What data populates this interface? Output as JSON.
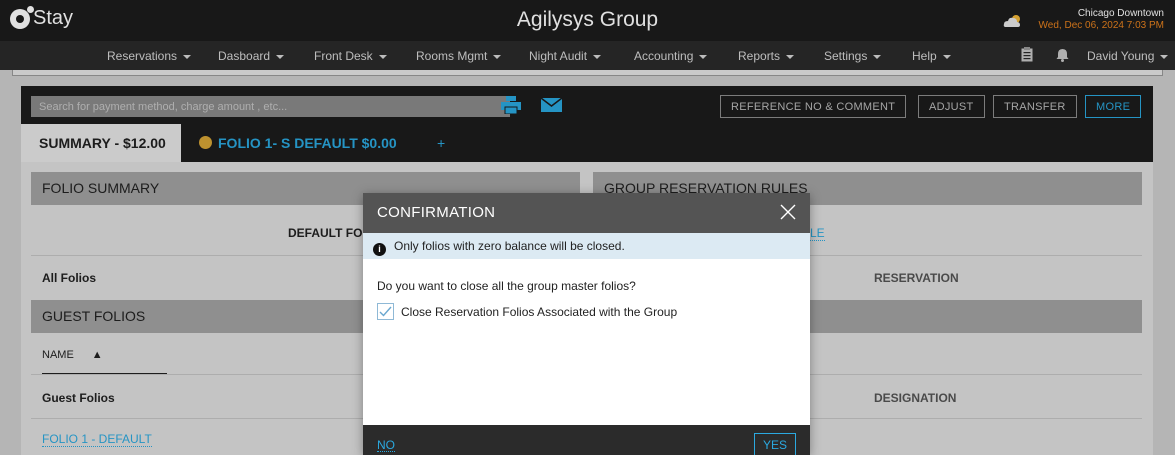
{
  "header": {
    "logo_text": "Stay",
    "title": "Agilysys Group",
    "location": "Chicago Downtown",
    "datetime": "Wed, Dec 06, 2024 7:03 PM",
    "weather_icon": "cloud-icon",
    "accent_color": "#e8821e"
  },
  "nav": {
    "items": [
      {
        "label": "Reservations"
      },
      {
        "label": "Dasboard"
      },
      {
        "label": "Front Desk"
      },
      {
        "label": "Rooms Mgmt"
      },
      {
        "label": "Night Audit"
      },
      {
        "label": "Accounting"
      },
      {
        "label": "Reports"
      },
      {
        "label": "Settings"
      },
      {
        "label": "Help"
      }
    ],
    "user": "David Young"
  },
  "toolbar": {
    "search_placeholder": "Search for payment method, charge amount , etc...",
    "reference_btn": "REFERENCE NO & COMMENT",
    "adjust_btn": "ADJUST",
    "transfer_btn": "TRANSFER",
    "more_btn": "MORE"
  },
  "tabs": {
    "summary": "SUMMARY - $12.00",
    "folio": "FOLIO 1- S DEFAULT $0.00",
    "add": "+"
  },
  "page": {
    "folio_summary": "FOLIO SUMMARY",
    "group_rules": "GROUP RESERVATION RULES",
    "default_folio_label": "DEFAULT FOL",
    "link_fragment": "LE",
    "all_folios": "All Folios",
    "reservation_col": "RESERVATION",
    "guest_folios_head": "GUEST FOLIOS",
    "name_col": "NAME",
    "guest_folios_row": "Guest Folios",
    "designation_col": "DESIGNATION",
    "folio_link": "FOLIO 1 - DEFAULT"
  },
  "modal": {
    "title": "CONFIRMATION",
    "info": "Only folios with zero balance will be closed.",
    "question": "Do you want to close all the group master folios?",
    "checkbox_label": "Close Reservation Folios Associated with the Group",
    "checkbox_checked": true,
    "no_label": "NO",
    "yes_label": "YES"
  }
}
